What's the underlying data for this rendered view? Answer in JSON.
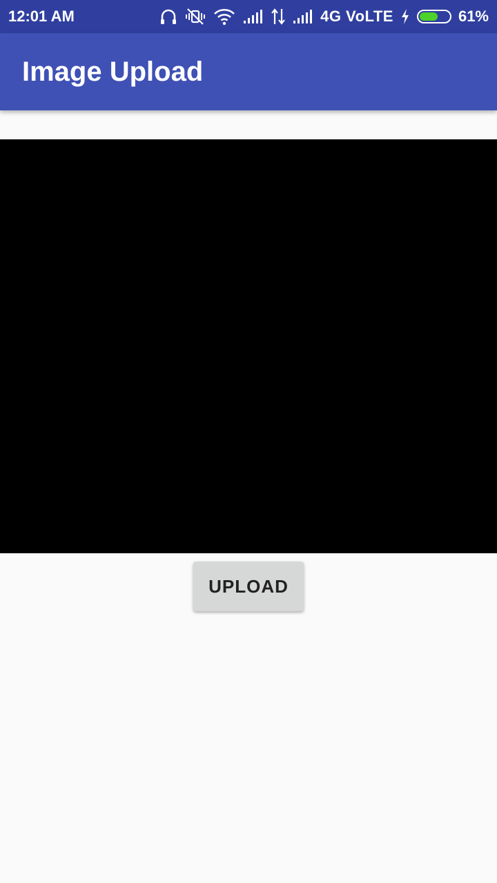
{
  "status_bar": {
    "time": "12:01 AM",
    "network_label": "4G VoLTE",
    "battery_percent_label": "61%",
    "battery_level": 0.61,
    "icons": [
      "headset-icon",
      "vibrate-off-icon",
      "wifi-icon",
      "signal-icon",
      "data-arrows-icon",
      "signal-icon",
      "charging-icon",
      "battery-icon"
    ]
  },
  "app_bar": {
    "title": "Image Upload"
  },
  "main": {
    "upload_label": "UPLOAD"
  },
  "colors": {
    "status_bar": "#303f9f",
    "app_bar": "#3f51b5",
    "background": "#fafafa",
    "button": "#d6d7d7",
    "battery_fill": "#4cd22a"
  }
}
